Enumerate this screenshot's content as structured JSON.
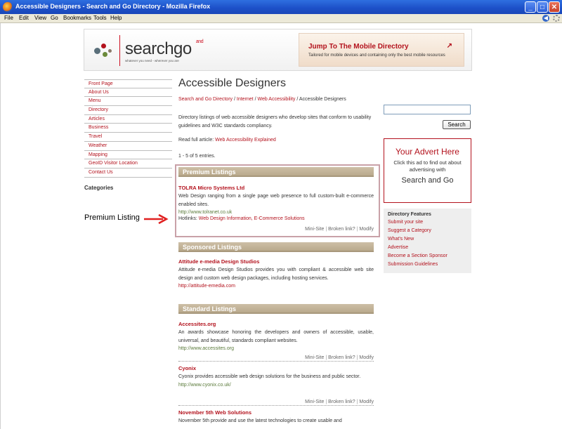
{
  "window": {
    "title": "Accessible Designers - Search and Go Directory - Mozilla Firefox"
  },
  "menu": [
    "File",
    "Edit",
    "View",
    "Go",
    "Bookmarks",
    "Tools",
    "Help"
  ],
  "header": {
    "logo_text": "searchgo",
    "logo_and": "and",
    "logo_tagline": "whatever you need - wherever you are",
    "mobile_title": "Jump To The Mobile Directory",
    "mobile_sub": "Tailored for mobile devices and containing only the best mobile resources"
  },
  "nav": [
    "Front Page",
    "About Us",
    "Menu",
    "Directory",
    "Articles",
    "Business",
    "Travel",
    "Weather",
    "Mapping",
    "GeoID Visitor Location",
    "Contact Us"
  ],
  "categories_label": "Categories",
  "annotation": "Premium Listing",
  "page": {
    "title": "Accessible Designers",
    "breadcrumb": [
      "Search and Go Directory",
      "Internet",
      "Web Accessibility",
      "Accessible Designers"
    ],
    "breadcrumb_sep": " / ",
    "intro": "Directory listings of web accessible designers who develop sites that conform to usability guidelines and W3C standards compliancy.",
    "read_full_prefix": "Read full article: ",
    "read_full_link": "Web Accessibility Explained",
    "entries": "1 - 5 of 5 entries."
  },
  "sections": {
    "premium": "Premium Listings",
    "sponsored": "Sponsored Listings",
    "standard": "Standard Listings"
  },
  "listings": {
    "tolra": {
      "title": "TOLRA Micro Systems Ltd",
      "desc": "Web Design ranging from a single page web presence to full custom-built e-commerce enabled sites.",
      "url": "http://www.tolranet.co.uk",
      "hotlinks_label": "Hotlinks:",
      "hotlinks": "Web Design Information, E-Commerce Solutions"
    },
    "attitude": {
      "title": "Attitude e-media Design Studios",
      "desc": "Attitude e-media Design Studios provides you with compliant & accessible web site design and custom web design packages, including hosting services.",
      "url": "http://attitude-emedia.com"
    },
    "accessites": {
      "title": "Accessites.org",
      "desc": "An awards showcase honoring the developers and owners of accessible, usable, universal, and beautiful, standards compliant websites.",
      "url": "http://www.accessites.org"
    },
    "cyonix": {
      "title": "Cyonix",
      "desc": "Cyonix provides accessible web design solutions for the business and public sector.",
      "url": "http://www.cyonix.co.uk/"
    },
    "november": {
      "title": "November 5th Web Solutions",
      "desc": "November 5th provide and use the latest technologies to create usable and"
    }
  },
  "actions": {
    "mini": "Mini-Site",
    "broken": "Broken link?",
    "modify": "Modify",
    "sep": " | "
  },
  "search": {
    "value": "",
    "button": "Search"
  },
  "advert": {
    "title": "Your Advert Here",
    "body": "Click this ad to find out about advertising with",
    "brand": "Search and Go"
  },
  "features": {
    "title": "Directory Features",
    "items": [
      "Submit your site",
      "Suggest a Category",
      "What's New",
      "Advertise",
      "Become a Section Sponsor",
      "Submission Guidelines"
    ]
  }
}
